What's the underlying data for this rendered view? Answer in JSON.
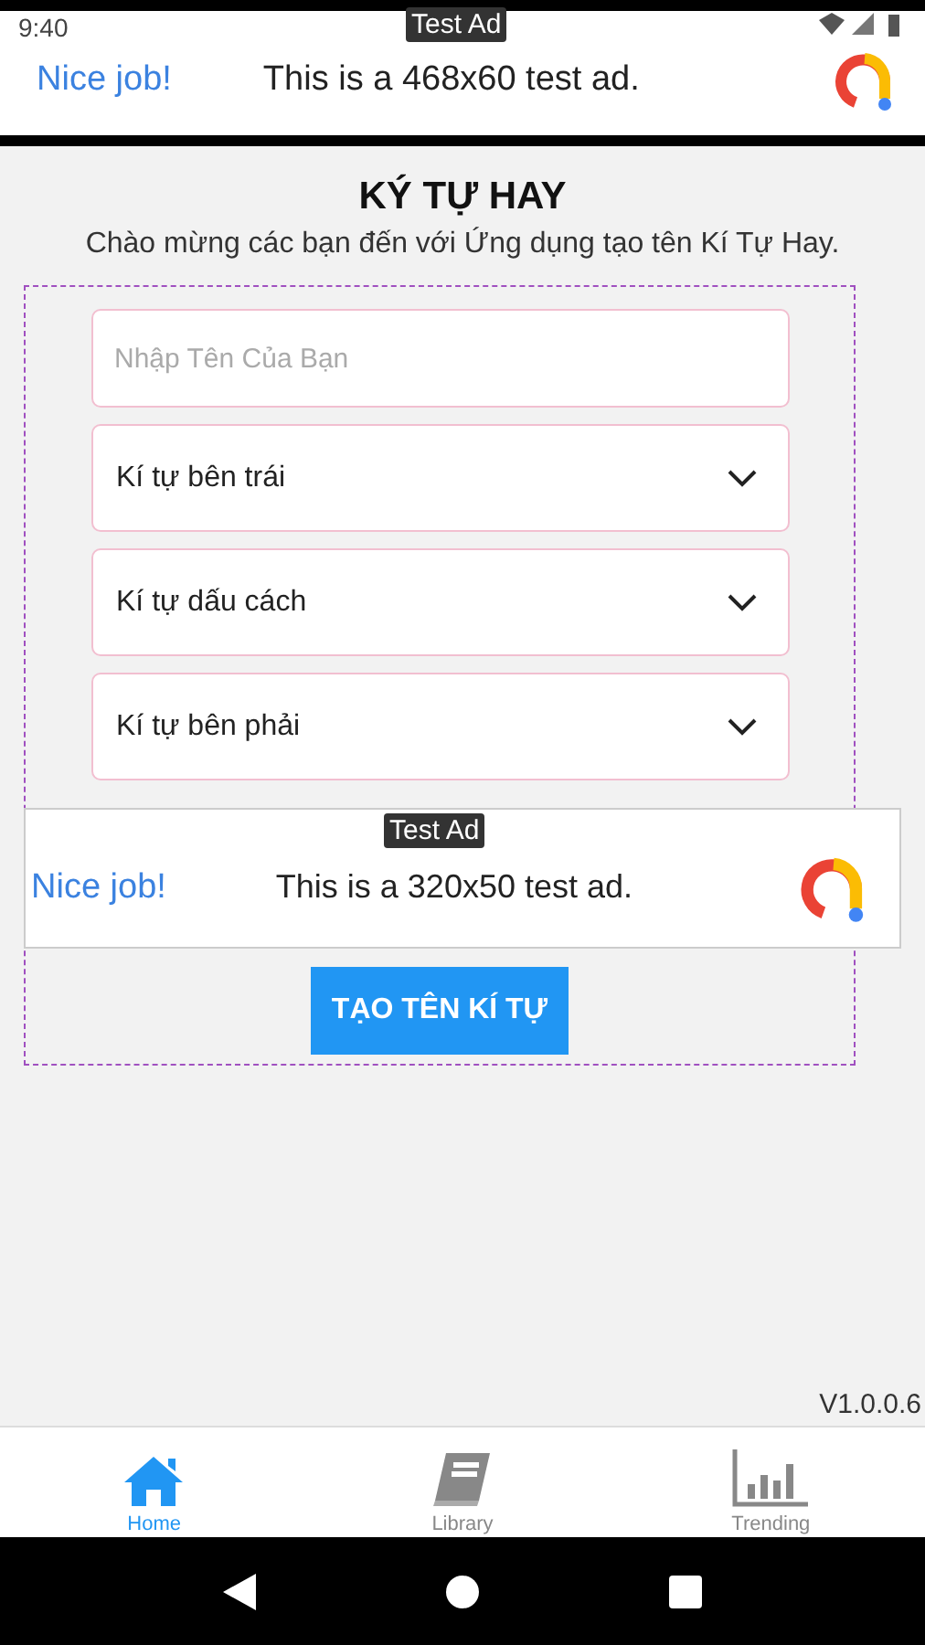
{
  "status_bar": {
    "time": "9:40"
  },
  "top_ad": {
    "badge": "Test Ad",
    "headline": "Nice job!",
    "text": "This is a 468x60 test ad."
  },
  "title": "KÝ TỰ HAY",
  "subtitle": "Chào mừng các bạn đến với Ứng dụng tạo tên Kí Tự Hay.",
  "name_field": {
    "placeholder": "Nhập Tên Của Bạn"
  },
  "dropdowns": [
    {
      "label": "Kí tự bên trái"
    },
    {
      "label": "Kí tự dấu cách"
    },
    {
      "label": "Kí tự bên phải"
    }
  ],
  "inline_ad": {
    "badge": "Test Ad",
    "headline": "Nice job!",
    "text": "This is a 320x50 test ad."
  },
  "create_button": "TẠO TÊN KÍ TỰ",
  "version": "V1.0.0.6",
  "tabs": [
    {
      "label": "Home",
      "kind": "home",
      "selected": true
    },
    {
      "label": "Library",
      "kind": "library",
      "selected": false
    },
    {
      "label": "Trending",
      "kind": "trending",
      "selected": false
    }
  ]
}
